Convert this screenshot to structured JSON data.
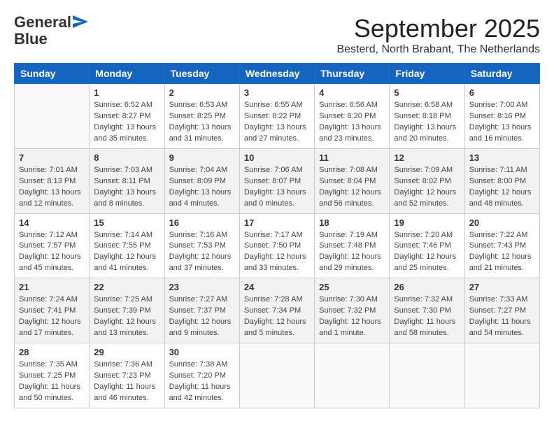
{
  "logo": {
    "general": "General",
    "blue": "Blue"
  },
  "title": "September 2025",
  "subtitle": "Besterd, North Brabant, The Netherlands",
  "days_of_week": [
    "Sunday",
    "Monday",
    "Tuesday",
    "Wednesday",
    "Thursday",
    "Friday",
    "Saturday"
  ],
  "weeks": [
    [
      {
        "day": "",
        "info": ""
      },
      {
        "day": "1",
        "info": "Sunrise: 6:52 AM\nSunset: 8:27 PM\nDaylight: 13 hours\nand 35 minutes."
      },
      {
        "day": "2",
        "info": "Sunrise: 6:53 AM\nSunset: 8:25 PM\nDaylight: 13 hours\nand 31 minutes."
      },
      {
        "day": "3",
        "info": "Sunrise: 6:55 AM\nSunset: 8:22 PM\nDaylight: 13 hours\nand 27 minutes."
      },
      {
        "day": "4",
        "info": "Sunrise: 6:56 AM\nSunset: 8:20 PM\nDaylight: 13 hours\nand 23 minutes."
      },
      {
        "day": "5",
        "info": "Sunrise: 6:58 AM\nSunset: 8:18 PM\nDaylight: 13 hours\nand 20 minutes."
      },
      {
        "day": "6",
        "info": "Sunrise: 7:00 AM\nSunset: 8:16 PM\nDaylight: 13 hours\nand 16 minutes."
      }
    ],
    [
      {
        "day": "7",
        "info": "Sunrise: 7:01 AM\nSunset: 8:13 PM\nDaylight: 13 hours\nand 12 minutes."
      },
      {
        "day": "8",
        "info": "Sunrise: 7:03 AM\nSunset: 8:11 PM\nDaylight: 13 hours\nand 8 minutes."
      },
      {
        "day": "9",
        "info": "Sunrise: 7:04 AM\nSunset: 8:09 PM\nDaylight: 13 hours\nand 4 minutes."
      },
      {
        "day": "10",
        "info": "Sunrise: 7:06 AM\nSunset: 8:07 PM\nDaylight: 13 hours\nand 0 minutes."
      },
      {
        "day": "11",
        "info": "Sunrise: 7:08 AM\nSunset: 8:04 PM\nDaylight: 12 hours\nand 56 minutes."
      },
      {
        "day": "12",
        "info": "Sunrise: 7:09 AM\nSunset: 8:02 PM\nDaylight: 12 hours\nand 52 minutes."
      },
      {
        "day": "13",
        "info": "Sunrise: 7:11 AM\nSunset: 8:00 PM\nDaylight: 12 hours\nand 48 minutes."
      }
    ],
    [
      {
        "day": "14",
        "info": "Sunrise: 7:12 AM\nSunset: 7:57 PM\nDaylight: 12 hours\nand 45 minutes."
      },
      {
        "day": "15",
        "info": "Sunrise: 7:14 AM\nSunset: 7:55 PM\nDaylight: 12 hours\nand 41 minutes."
      },
      {
        "day": "16",
        "info": "Sunrise: 7:16 AM\nSunset: 7:53 PM\nDaylight: 12 hours\nand 37 minutes."
      },
      {
        "day": "17",
        "info": "Sunrise: 7:17 AM\nSunset: 7:50 PM\nDaylight: 12 hours\nand 33 minutes."
      },
      {
        "day": "18",
        "info": "Sunrise: 7:19 AM\nSunset: 7:48 PM\nDaylight: 12 hours\nand 29 minutes."
      },
      {
        "day": "19",
        "info": "Sunrise: 7:20 AM\nSunset: 7:46 PM\nDaylight: 12 hours\nand 25 minutes."
      },
      {
        "day": "20",
        "info": "Sunrise: 7:22 AM\nSunset: 7:43 PM\nDaylight: 12 hours\nand 21 minutes."
      }
    ],
    [
      {
        "day": "21",
        "info": "Sunrise: 7:24 AM\nSunset: 7:41 PM\nDaylight: 12 hours\nand 17 minutes."
      },
      {
        "day": "22",
        "info": "Sunrise: 7:25 AM\nSunset: 7:39 PM\nDaylight: 12 hours\nand 13 minutes."
      },
      {
        "day": "23",
        "info": "Sunrise: 7:27 AM\nSunset: 7:37 PM\nDaylight: 12 hours\nand 9 minutes."
      },
      {
        "day": "24",
        "info": "Sunrise: 7:28 AM\nSunset: 7:34 PM\nDaylight: 12 hours\nand 5 minutes."
      },
      {
        "day": "25",
        "info": "Sunrise: 7:30 AM\nSunset: 7:32 PM\nDaylight: 12 hours\nand 1 minute."
      },
      {
        "day": "26",
        "info": "Sunrise: 7:32 AM\nSunset: 7:30 PM\nDaylight: 11 hours\nand 58 minutes."
      },
      {
        "day": "27",
        "info": "Sunrise: 7:33 AM\nSunset: 7:27 PM\nDaylight: 11 hours\nand 54 minutes."
      }
    ],
    [
      {
        "day": "28",
        "info": "Sunrise: 7:35 AM\nSunset: 7:25 PM\nDaylight: 11 hours\nand 50 minutes."
      },
      {
        "day": "29",
        "info": "Sunrise: 7:36 AM\nSunset: 7:23 PM\nDaylight: 11 hours\nand 46 minutes."
      },
      {
        "day": "30",
        "info": "Sunrise: 7:38 AM\nSunset: 7:20 PM\nDaylight: 11 hours\nand 42 minutes."
      },
      {
        "day": "",
        "info": ""
      },
      {
        "day": "",
        "info": ""
      },
      {
        "day": "",
        "info": ""
      },
      {
        "day": "",
        "info": ""
      }
    ]
  ]
}
